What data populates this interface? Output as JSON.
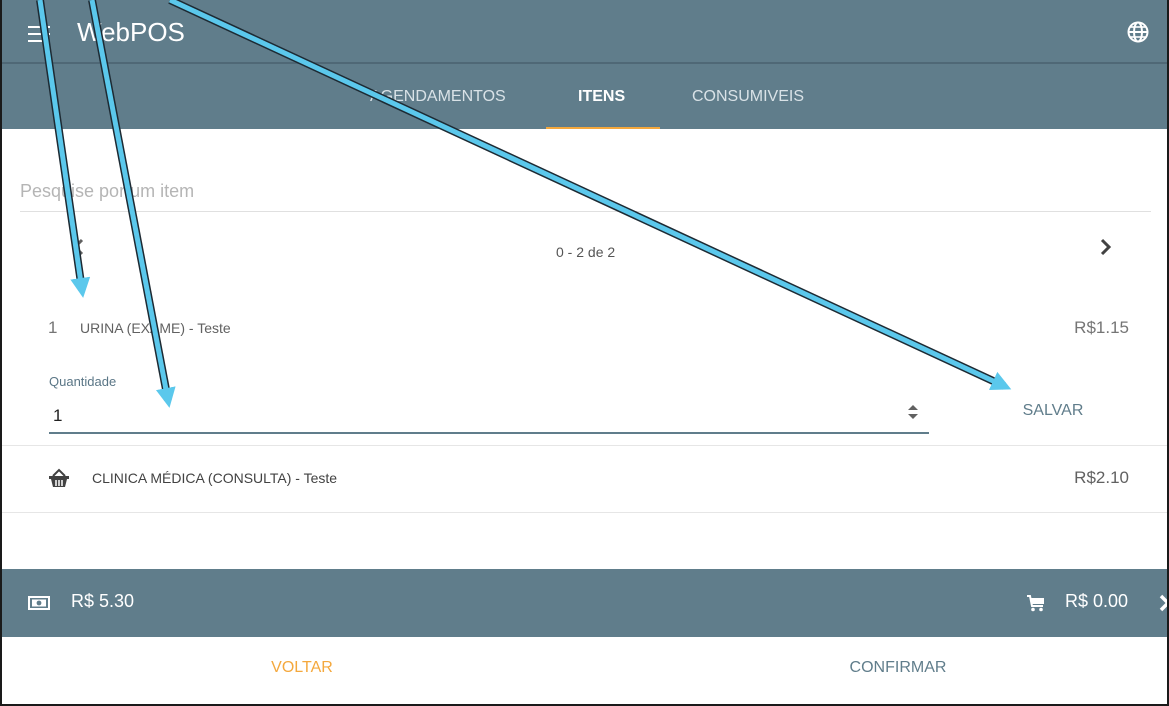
{
  "app": {
    "title": "WebPOS"
  },
  "tabs": [
    {
      "label": "AGENDAMENTOS",
      "active": false
    },
    {
      "label": "ITENS",
      "active": true
    },
    {
      "label": "CONSUMIVEIS",
      "active": false
    }
  ],
  "search": {
    "placeholder": "Pesquise por um item",
    "value": ""
  },
  "pagination": {
    "text": "0 - 2 de 2"
  },
  "items": [
    {
      "quantity": "1",
      "name": "URINA (EXAME) - Teste",
      "price": "R$1.15",
      "editor": {
        "label": "Quantidade",
        "value": "1",
        "save_label": "SALVAR"
      }
    },
    {
      "icon": "basket-icon",
      "name": "CLINICA MÉDICA (CONSULTA) - Teste",
      "price": "R$2.10"
    }
  ],
  "summary": {
    "total": "R$ 5.30",
    "cart_total": "R$ 0.00"
  },
  "footer": {
    "back_label": "VOLTAR",
    "confirm_label": "CONFIRMAR"
  },
  "colors": {
    "primary": "#607d8b",
    "accent": "#f4a83d",
    "annotation_arrow": "#5bc8ec"
  }
}
